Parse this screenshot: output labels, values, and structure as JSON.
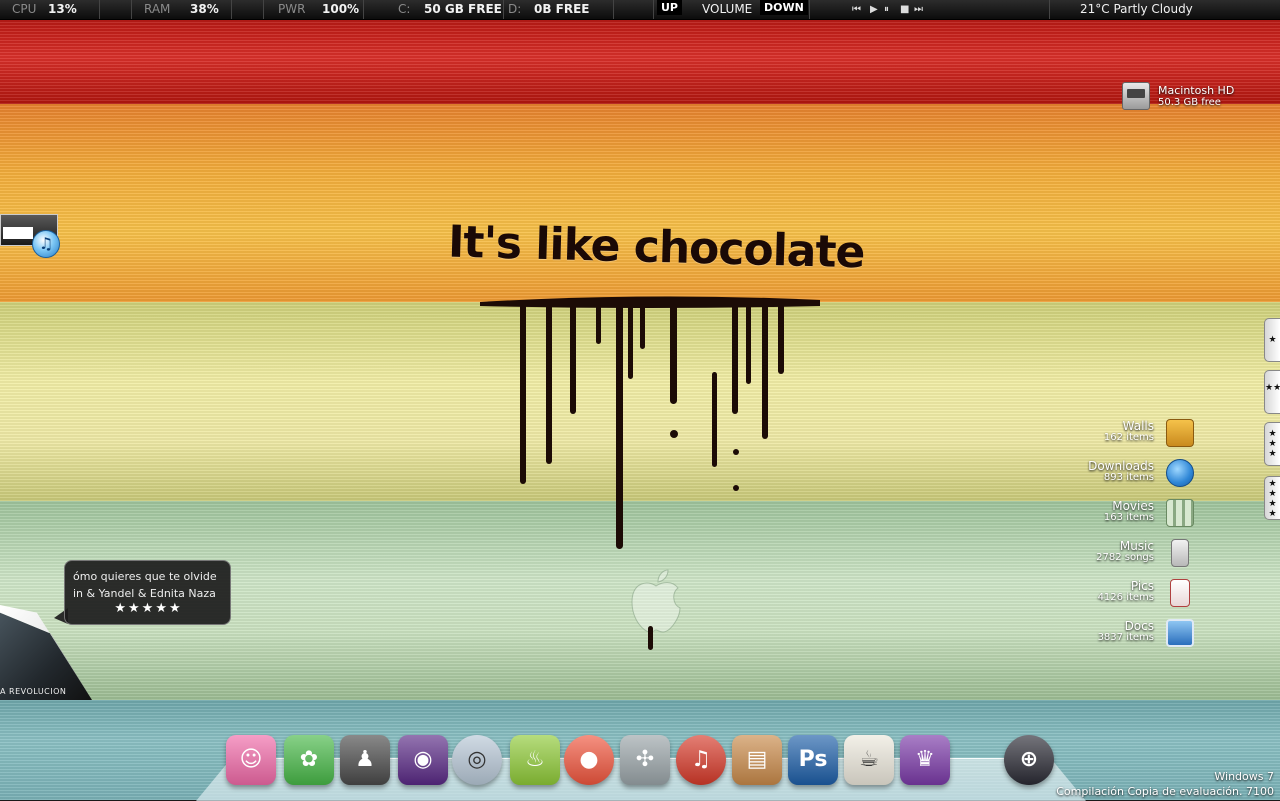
{
  "topbar": {
    "cpu_label": "CPU",
    "cpu_value": "13%",
    "ram_label": "RAM",
    "ram_value": "38%",
    "pwr_label": "PWR",
    "pwr_value": "100%",
    "c_label": "C:",
    "c_value": "50 GB FREE",
    "d_label": "D:",
    "d_value": "0B FREE",
    "vol_up": "UP",
    "vol_label": "VOLUME",
    "vol_down": "DOWN",
    "media": {
      "prev": "⏮",
      "play": "▶",
      "pause": "⏸",
      "stop": "■",
      "next": "⏭"
    },
    "weather": "21°C Partly Cloudy"
  },
  "wallpaper": {
    "headline": "It's like chocolate"
  },
  "drive": {
    "name": "Macintosh HD",
    "free": "50.3 GB free"
  },
  "stacks": [
    {
      "name": "Walls",
      "count": "162 items",
      "icon": "folder-icon"
    },
    {
      "name": "Downloads",
      "count": "893 items",
      "icon": "bird-icon"
    },
    {
      "name": "Movies",
      "count": "163 items",
      "icon": "bottles-icon"
    },
    {
      "name": "Music",
      "count": "2782 songs",
      "icon": "ipod-icon"
    },
    {
      "name": "Pics",
      "count": "4126 items",
      "icon": "photo-icon"
    },
    {
      "name": "Docs",
      "count": "3837 items",
      "icon": "screen-icon"
    }
  ],
  "side_tabs": [
    "★",
    "★★",
    "★★★",
    "★★★★"
  ],
  "now_playing": {
    "title": "ómo quieres que te olvide",
    "artist": "in & Yandel & Ednita Naza",
    "rating_stars": 5,
    "rating": "★★★★★",
    "album_text": "A REVOLUCION"
  },
  "dock": [
    {
      "name": "finder-face-icon",
      "glyph": "☺",
      "color": "#f06aa8"
    },
    {
      "name": "flower-icon",
      "glyph": "✿",
      "color": "#48b848"
    },
    {
      "name": "darth-vader-icon",
      "glyph": "♟",
      "color": "#4a4a4a"
    },
    {
      "name": "purple-monster-icon",
      "glyph": "◉",
      "color": "#5a2a86"
    },
    {
      "name": "cd-disc-icon",
      "glyph": "◎",
      "color": "#b7c7d6"
    },
    {
      "name": "soda-cup-icon",
      "glyph": "♨",
      "color": "#8fca38"
    },
    {
      "name": "grapefruit-icon",
      "glyph": "●",
      "color": "#f0563e"
    },
    {
      "name": "windmill-icon",
      "glyph": "✣",
      "color": "#9aa4a8"
    },
    {
      "name": "itunes-note-icon",
      "glyph": "♫",
      "color": "#d63a2a"
    },
    {
      "name": "toast-box-icon",
      "glyph": "▤",
      "color": "#c98a4a"
    },
    {
      "name": "photoshop-icon",
      "glyph": "Ps",
      "color": "#1e5fa8"
    },
    {
      "name": "newspaper-icon",
      "glyph": "☕",
      "color": "#ece8dc"
    },
    {
      "name": "ice-pop-icon",
      "glyph": "♛",
      "color": "#7b3aa8"
    },
    {
      "name": "crystal-ball-icon",
      "glyph": "⊕",
      "color": "#2b2b35"
    }
  ],
  "windows": {
    "line1": "Windows 7",
    "line2": "Compilación Copia de evaluación. 7100"
  }
}
